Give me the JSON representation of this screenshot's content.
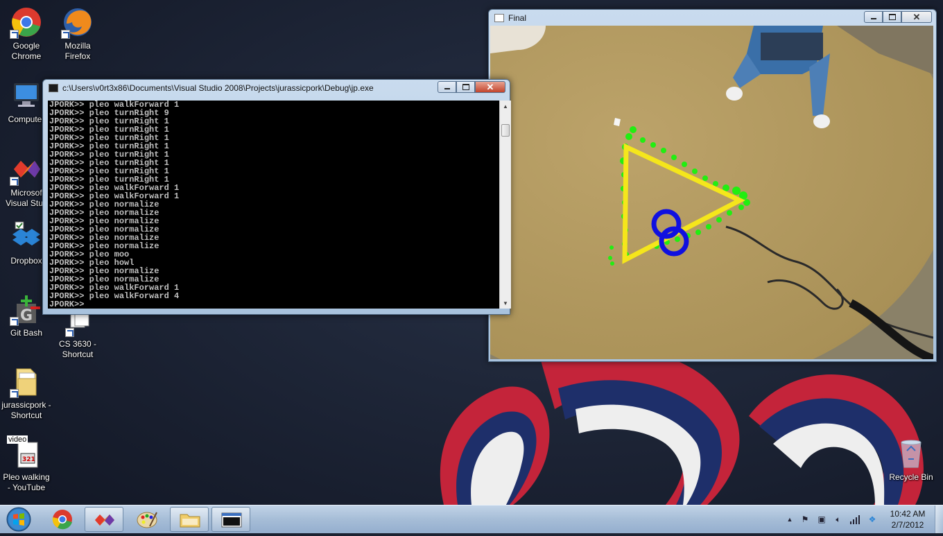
{
  "desktop": {
    "icons": [
      {
        "label": "Google Chrome"
      },
      {
        "label": "Mozilla Firefox"
      },
      {
        "label": "Computer"
      },
      {
        "label": "Microsoft Visual Studio"
      },
      {
        "label": "Dropbox"
      },
      {
        "label": "Git Bash"
      },
      {
        "label": "CS 3630 - Shortcut"
      },
      {
        "label": "jurassicpork - Shortcut"
      },
      {
        "label": "Pleo walking - YouTube",
        "badge": "video"
      },
      {
        "label": "Recycle Bin"
      }
    ],
    "ms_lines": [
      "Microsof",
      "Visual Stuc"
    ],
    "chrome_lines": [
      "Google",
      "Chrome"
    ],
    "firefox_lines": [
      "Mozilla",
      "Firefox"
    ],
    "cs_lines": [
      "CS 3630 -",
      "Shortcut"
    ],
    "jp_lines": [
      "jurassicpork -",
      "Shortcut"
    ],
    "pleo_lines": [
      "Pleo walking",
      "- YouTube"
    ]
  },
  "console_window": {
    "title": "c:\\Users\\v0rt3x86\\Documents\\Visual Studio 2008\\Projects\\jurassicpork\\Debug\\jp.exe",
    "lines": [
      "JPORK>> pleo walkForward 1",
      "JPORK>> pleo turnRight 9",
      "JPORK>> pleo turnRight 1",
      "JPORK>> pleo turnRight 1",
      "JPORK>> pleo turnRight 1",
      "JPORK>> pleo turnRight 1",
      "JPORK>> pleo turnRight 1",
      "JPORK>> pleo turnRight 1",
      "JPORK>> pleo turnRight 1",
      "JPORK>> pleo turnRight 1",
      "JPORK>> pleo walkForward 1",
      "JPORK>> pleo walkForward 1",
      "JPORK>> pleo normalize",
      "JPORK>> pleo normalize",
      "JPORK>> pleo normalize",
      "JPORK>> pleo normalize",
      "JPORK>> pleo normalize",
      "JPORK>> pleo normalize",
      "JPORK>> pleo moo",
      "JPORK>> pleo howl",
      "JPORK>> pleo normalize",
      "JPORK>> pleo normalize",
      "JPORK>> pleo walkForward 1",
      "JPORK>> pleo walkForward 4",
      "JPORK>>"
    ]
  },
  "camera_window": {
    "title": "Final"
  },
  "taskbar": {
    "time": "10:42 AM",
    "date": "2/7/2012"
  },
  "colors": {
    "triangle": "#f5e61b",
    "trail": "#22ee11",
    "marker": "#1010e0",
    "console_text": "#c0c0c0",
    "floor": "#b39a5e"
  }
}
